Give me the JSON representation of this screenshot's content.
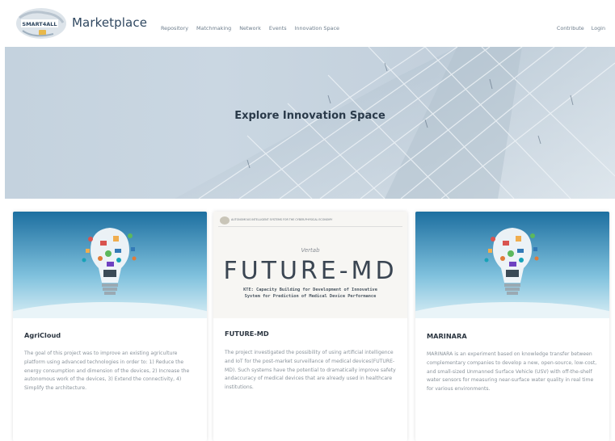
{
  "header": {
    "logo_text": "SMART4ALL",
    "brand": "Marketplace",
    "nav": [
      "Repository",
      "Matchmaking",
      "Network",
      "Events",
      "Innovation Space"
    ],
    "nav_right": [
      "Contribute",
      "Login"
    ]
  },
  "hero": {
    "title": "Explore Innovation Space"
  },
  "cards": [
    {
      "title": "AgriCloud",
      "image_icon": "lightbulb-icon",
      "description": "The goal of this project was to improve an existing agriculture platform using advanced technologies in order to: 1) Reduce the energy consumption and dimension of the devices, 2) Increase the autonomous work of the devices, 3) Extend the connectivity, 4) Simplify the architecture."
    },
    {
      "title": "FUTURE-MD",
      "image": {
        "header_text": "AUTONOMOUS INTELLIGENT SYSTEMS FOR THE CYBER-PHYSICAL ECONOMY",
        "org": "Vertab",
        "big": "FUTURE-MD",
        "sub": "KTE: Capacity Building for Development of Innovative System for Prediction of Medical Device Performance"
      },
      "description": "The project investigated the possibility of using artificial intelligence and IoT for the post-market surveillance of medical devices(FUTURE-MD). Such systems have the potential to dramatically improve safety andaccuracy of medical devices that are already used in healthcare institutions."
    },
    {
      "title": "MARINARA",
      "image_icon": "lightbulb-icon",
      "description": "MARINARA is an experiment based on knowledge transfer between complementary companies to develop a new, open-source, low-cost, and small-sized Unmanned Surface Vehicle (USV) with off-the-shelf water sensors for measuring near-surface water quality in real time for various environments."
    }
  ]
}
